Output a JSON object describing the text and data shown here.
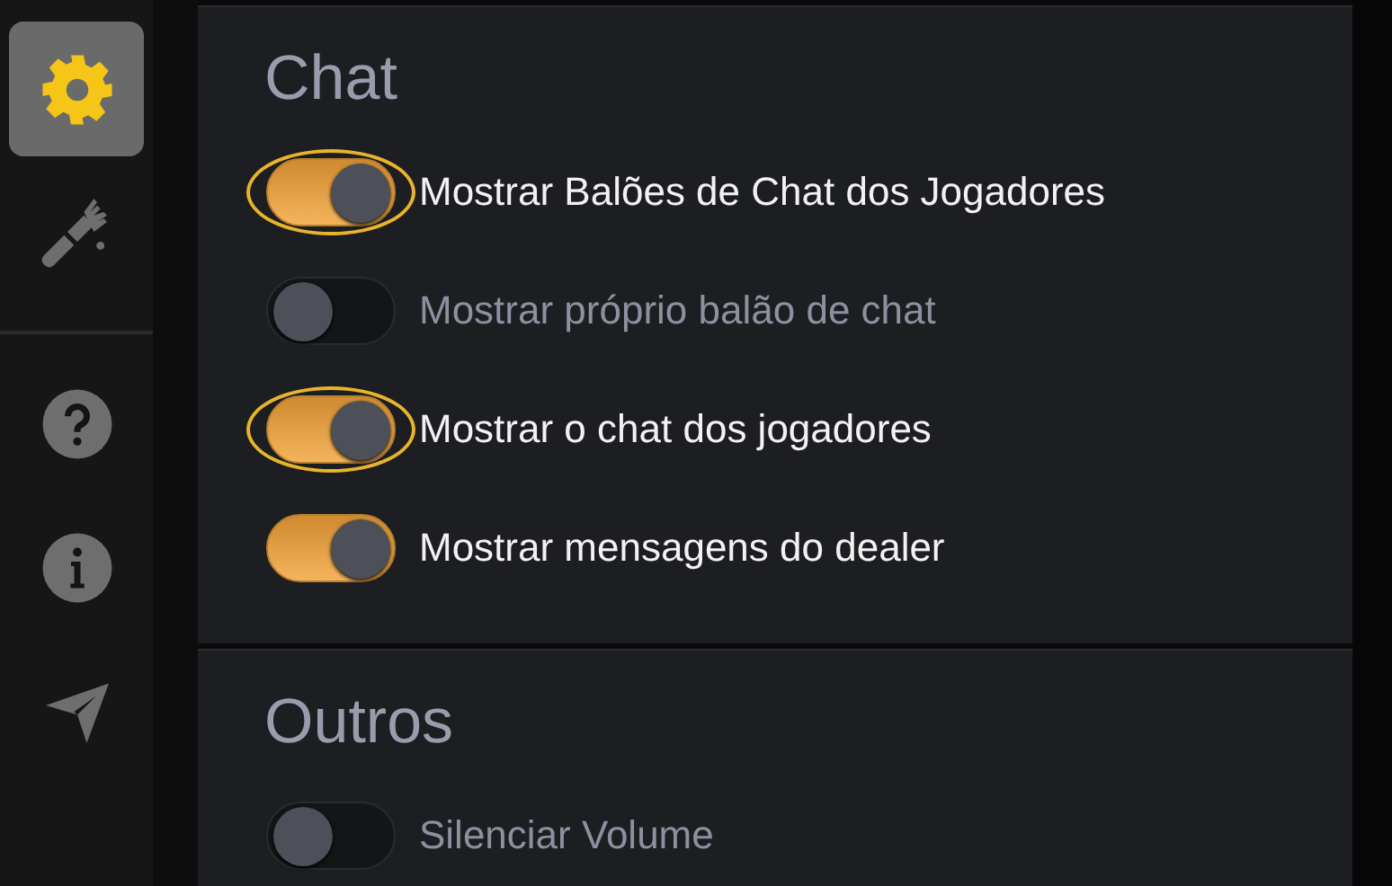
{
  "sidebar": {
    "top_items": [
      {
        "kind": "gear",
        "selected": true
      },
      {
        "kind": "brush",
        "selected": false
      }
    ],
    "bottom_items": [
      {
        "kind": "help",
        "selected": false
      },
      {
        "kind": "info",
        "selected": false
      },
      {
        "kind": "send",
        "selected": false
      }
    ]
  },
  "sections": [
    {
      "title": "Chat",
      "options": [
        {
          "label": "Mostrar Balões de Chat dos Jogadores",
          "on": true,
          "focused": true
        },
        {
          "label": "Mostrar próprio balão de chat",
          "on": false,
          "focused": false
        },
        {
          "label": "Mostrar o chat dos jogadores",
          "on": true,
          "focused": true
        },
        {
          "label": "Mostrar mensagens do dealer",
          "on": true,
          "focused": false
        }
      ]
    },
    {
      "title": "Outros",
      "options": [
        {
          "label": "Silenciar Volume",
          "on": false,
          "focused": false
        }
      ]
    }
  ]
}
